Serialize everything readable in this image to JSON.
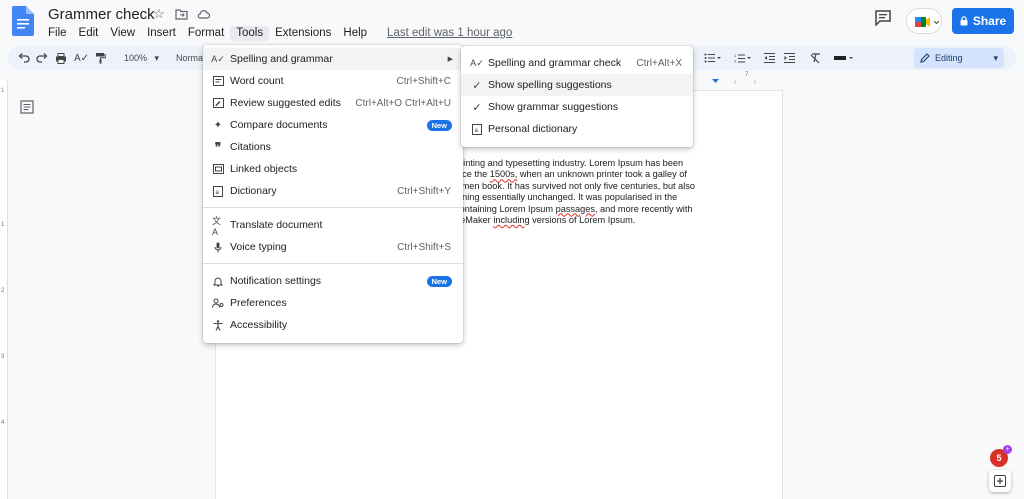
{
  "header": {
    "title": "Grammer check",
    "menus": [
      "File",
      "Edit",
      "View",
      "Insert",
      "Format",
      "Tools",
      "Extensions",
      "Help"
    ],
    "last_edit": "Last edit was 1 hour ago",
    "share_label": "Share"
  },
  "toolbar": {
    "zoom": "100%",
    "style": "Normal",
    "mode": "Editing"
  },
  "ruler": {
    "marks": [
      "1",
      "1",
      "2",
      "3",
      "4"
    ],
    "top_mark": "7"
  },
  "tools_menu": {
    "items": [
      {
        "label": "Spelling and grammar",
        "shortcut": "",
        "icon": "spellcheck-icon"
      },
      {
        "label": "Word count",
        "shortcut": "Ctrl+Shift+C",
        "icon": "word-count-icon"
      },
      {
        "label": "Review suggested edits",
        "shortcut": "Ctrl+Alt+O Ctrl+Alt+U",
        "icon": "review-edits-icon"
      },
      {
        "label": "Compare documents",
        "shortcut": "",
        "badge": "New",
        "icon": "compare-icon"
      },
      {
        "label": "Citations",
        "shortcut": "",
        "icon": "quote-icon"
      },
      {
        "label": "Linked objects",
        "shortcut": "",
        "icon": "link-icon"
      },
      {
        "label": "Dictionary",
        "shortcut": "Ctrl+Shift+Y",
        "icon": "dictionary-icon"
      },
      {
        "label": "Translate document",
        "shortcut": "",
        "icon": "translate-icon"
      },
      {
        "label": "Voice typing",
        "shortcut": "Ctrl+Shift+S",
        "icon": "mic-icon"
      },
      {
        "label": "Notification settings",
        "shortcut": "",
        "badge": "New",
        "icon": "bell-icon"
      },
      {
        "label": "Preferences",
        "shortcut": "",
        "icon": "preferences-icon"
      },
      {
        "label": "Accessibility",
        "shortcut": "",
        "icon": "accessibility-icon"
      }
    ]
  },
  "spelling_menu": {
    "items": [
      {
        "label": "Spelling and grammar check",
        "shortcut": "Ctrl+Alt+X",
        "icon": "spellcheck-icon"
      },
      {
        "label": "Show spelling suggestions",
        "shortcut": "",
        "icon": "check-icon"
      },
      {
        "label": "Show grammar suggestions",
        "shortcut": "",
        "icon": "check-icon"
      },
      {
        "label": "Personal dictionary",
        "shortcut": "",
        "icon": "dictionary-icon"
      }
    ]
  },
  "document": {
    "line1": "printing and typesetting industry. Lorem Ipsum has been",
    "line2a": "ince the ",
    "line2b": "1500s,",
    "line2c": " when an unknown printer took a galley of",
    "line3": "cimen book. It has survived not only five centuries, but also",
    "line4": "aining essentially unchanged. It was popularised in the",
    "line5a": "containing Lorem Ipsum ",
    "line5b": "passages,",
    "line5c": " and more recently with",
    "line6a": "geMaker ",
    "line6b": "including",
    "line6c": " versions of Lorem Ipsum."
  },
  "notifications": {
    "count": "5"
  },
  "colors": {
    "accent": "#1a73e8",
    "badge": "#d93025"
  }
}
